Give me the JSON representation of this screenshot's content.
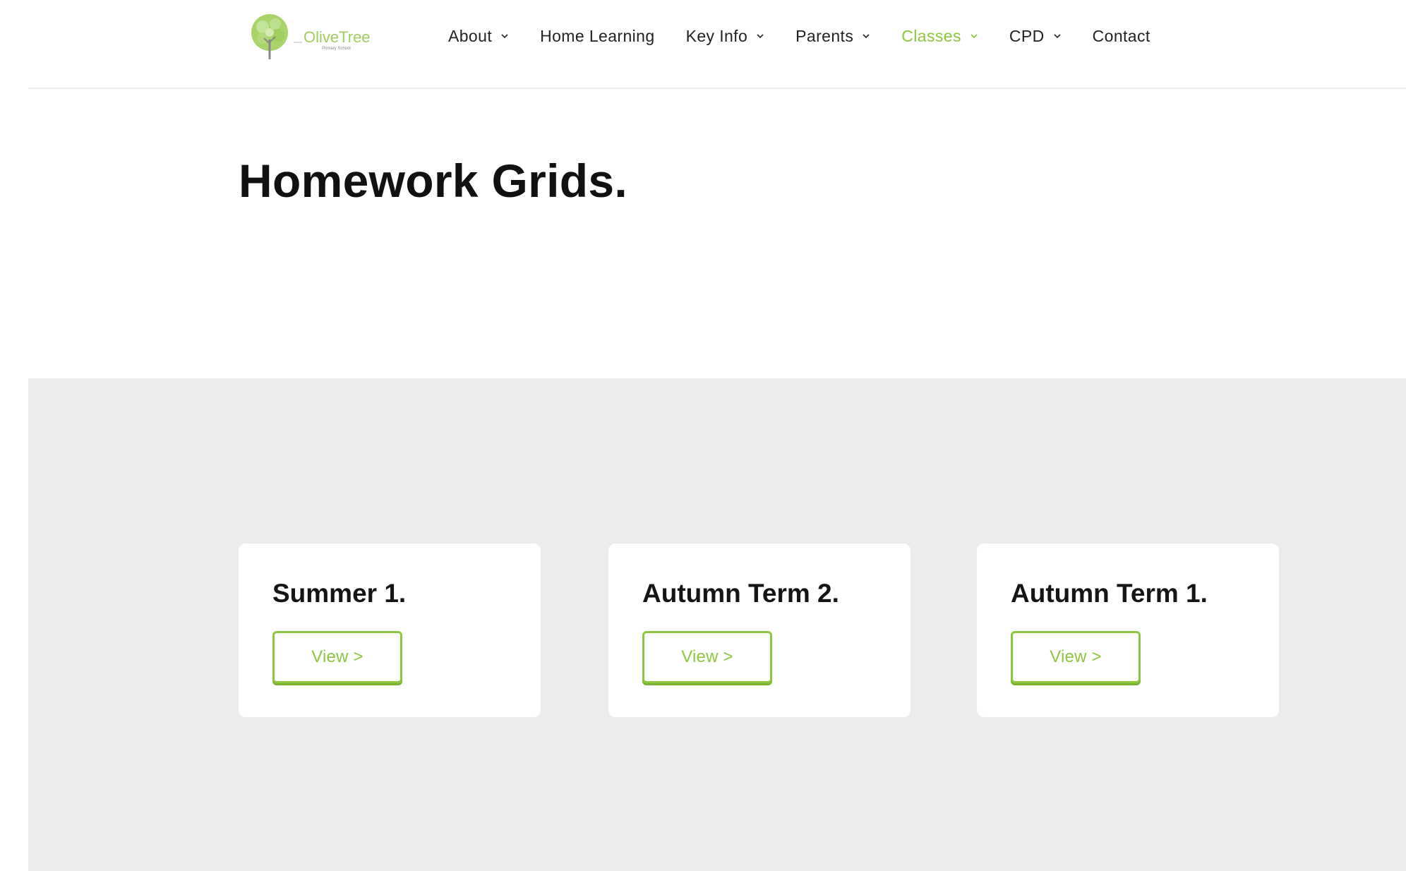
{
  "colors": {
    "accent": "#8dc63f",
    "band_background": "#ebebeb",
    "text": "#111111"
  },
  "logo": {
    "icon": "tree-logo-icon",
    "wordmark": "OliveTree",
    "tagline": "Primary School"
  },
  "nav": {
    "items": [
      {
        "label": "About",
        "has_dropdown": true,
        "active": false
      },
      {
        "label": "Home Learning",
        "has_dropdown": false,
        "active": false
      },
      {
        "label": "Key Info",
        "has_dropdown": true,
        "active": false
      },
      {
        "label": "Parents",
        "has_dropdown": true,
        "active": false
      },
      {
        "label": "Classes",
        "has_dropdown": true,
        "active": true
      },
      {
        "label": "CPD",
        "has_dropdown": true,
        "active": false
      },
      {
        "label": "Contact",
        "has_dropdown": false,
        "active": false
      }
    ]
  },
  "page": {
    "title": "Homework Grids."
  },
  "cards": [
    {
      "title": "Summer 1.",
      "button_label": "View >"
    },
    {
      "title": "Autumn Term 2.",
      "button_label": "View >"
    },
    {
      "title": "Autumn Term 1.",
      "button_label": "View >"
    }
  ]
}
